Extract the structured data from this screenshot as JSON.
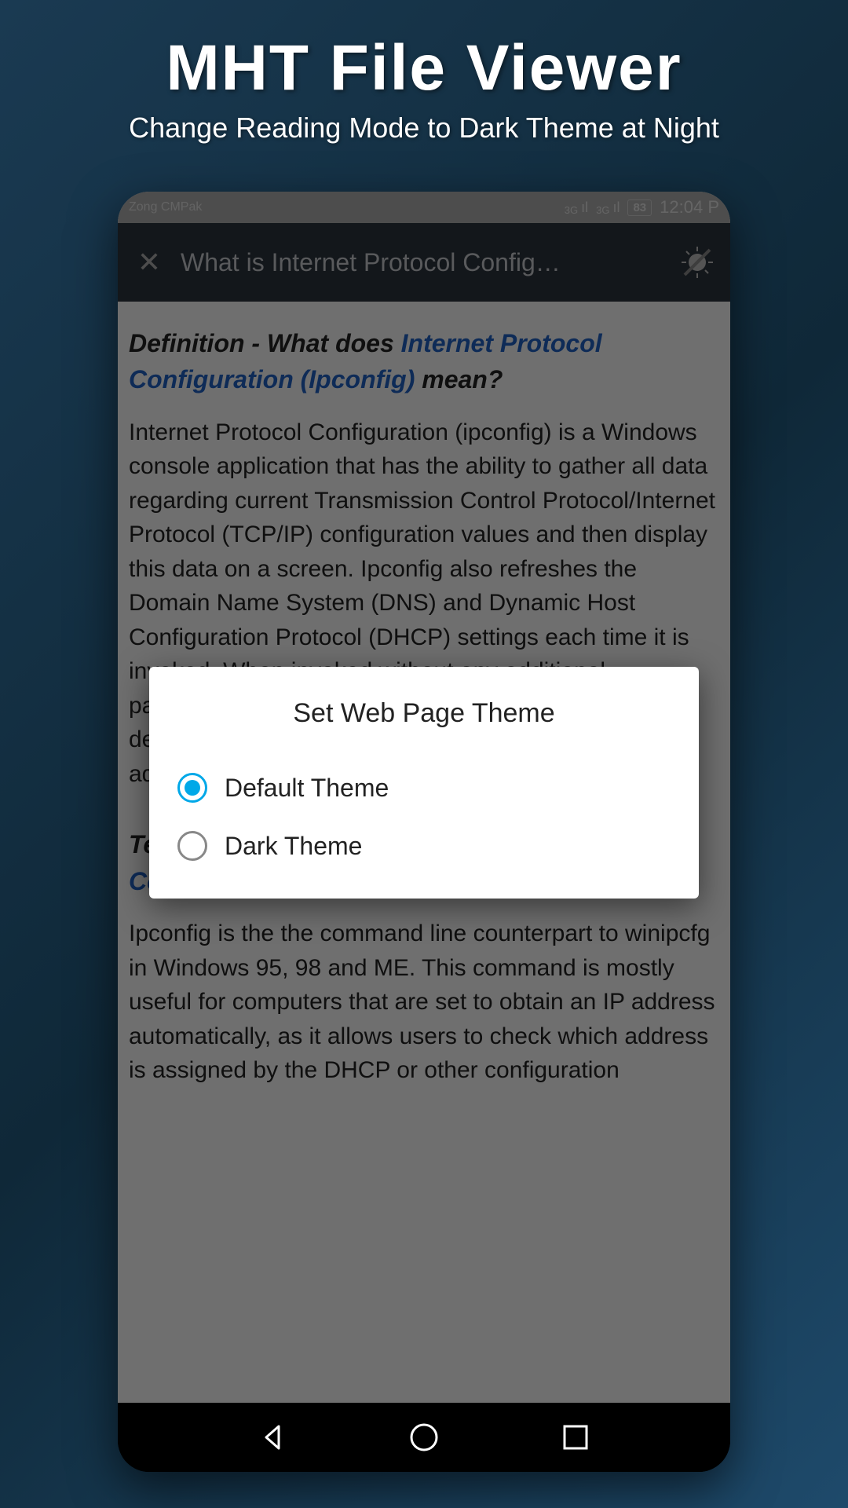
{
  "promo": {
    "title": "MHT File Viewer",
    "subtitle": "Change Reading Mode to Dark Theme at Night"
  },
  "status_bar": {
    "carrier": "Zong CMPak",
    "network_label_1": "3G",
    "network_label_2": "3G",
    "battery": "83",
    "time": "12:04 P"
  },
  "app_bar": {
    "title": "What is Internet Protocol Config…"
  },
  "content": {
    "heading_prefix": "Definition - What does ",
    "heading_link": "Internet Protocol Configuration (Ipconfig)",
    "heading_suffix": " mean?",
    "para1": "Internet Protocol Configuration (ipconfig) is a Windows console application that has the ability to gather all data regarding current Transmission Control Protocol/Internet Protocol (TCP/IP) configuration values and then display this data on a screen. Ipconfig also refreshes the Domain Name System (DNS) and Dynamic Host Configuration Protocol (DHCP) settings each time it is invoked. When invoked without any additional parameters, ipconfig simply displays the IP address, default gateway and subnet mask for all available adapters.",
    "second_heading_prefix": "Techopedia explains ",
    "second_heading_link": "Internet Protocol Configuration (Ipconfig)",
    "para2": "Ipconfig is the the command line counterpart to winipcfg in Windows 95, 98 and ME. This command is mostly useful for computers that are set to obtain an IP address automatically, as it allows users to check which address is assigned by the DHCP or other configuration"
  },
  "dialog": {
    "title": "Set Web Page Theme",
    "options": [
      {
        "label": "Default Theme",
        "selected": true
      },
      {
        "label": "Dark Theme",
        "selected": false
      }
    ]
  }
}
